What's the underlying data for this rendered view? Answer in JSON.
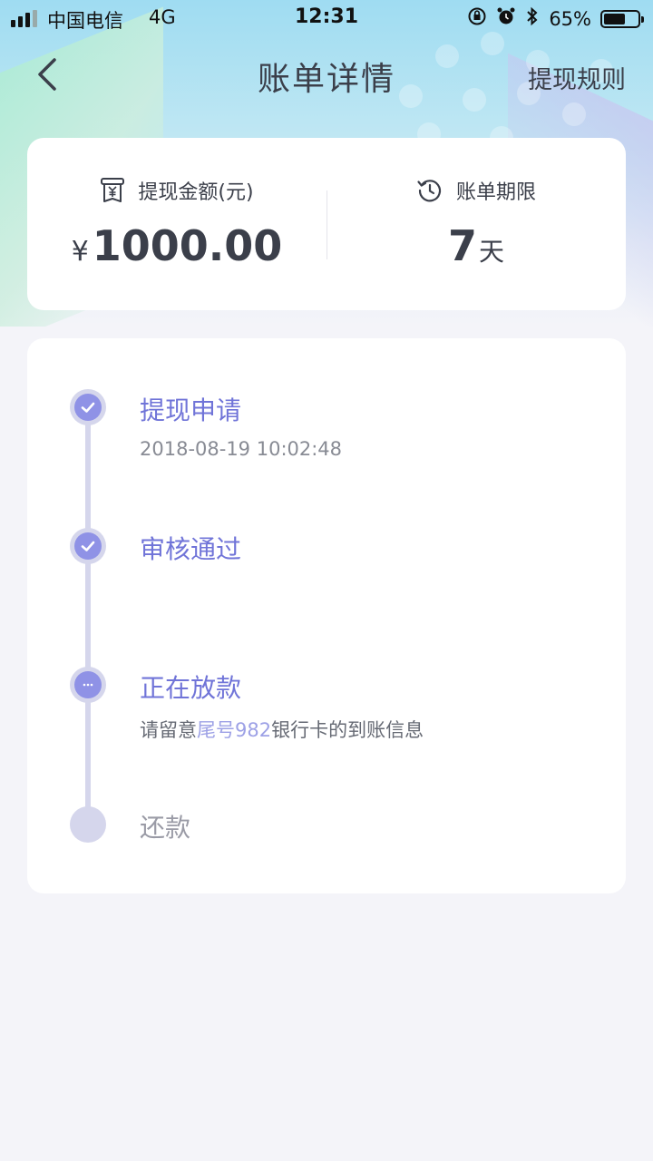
{
  "status_bar": {
    "carrier": "中国电信",
    "network": "4G",
    "time": "12:31",
    "battery_percent": "65%",
    "battery_level": 0.65,
    "icons": [
      "orientation-lock-icon",
      "alarm-icon",
      "bluetooth-icon"
    ]
  },
  "nav": {
    "title": "账单详情",
    "rules_link": "提现规则",
    "back_icon": "chevron-left-icon"
  },
  "summary": {
    "amount_label": "提现金额(元)",
    "amount_symbol": "¥",
    "amount_value": "1000.00",
    "period_label": "账单期限",
    "period_value": "7",
    "period_unit": "天"
  },
  "timeline": {
    "steps": [
      {
        "title": "提现申请",
        "time": "2018-08-19 10:02:48",
        "state": "done"
      },
      {
        "title": "审核通过",
        "state": "done"
      },
      {
        "title": "正在放款",
        "note_prefix": "请留意",
        "note_highlight": "尾号982",
        "note_suffix": "银行卡的到账信息",
        "state": "in-progress"
      },
      {
        "title": "还款",
        "state": "pending"
      }
    ]
  },
  "colors": {
    "accent": "#7074d8",
    "dot_active": "#8f92e6",
    "dot_ring": "#d5d6ec",
    "text_dark": "#3b3f4a",
    "page_bg": "#f4f4f9"
  }
}
